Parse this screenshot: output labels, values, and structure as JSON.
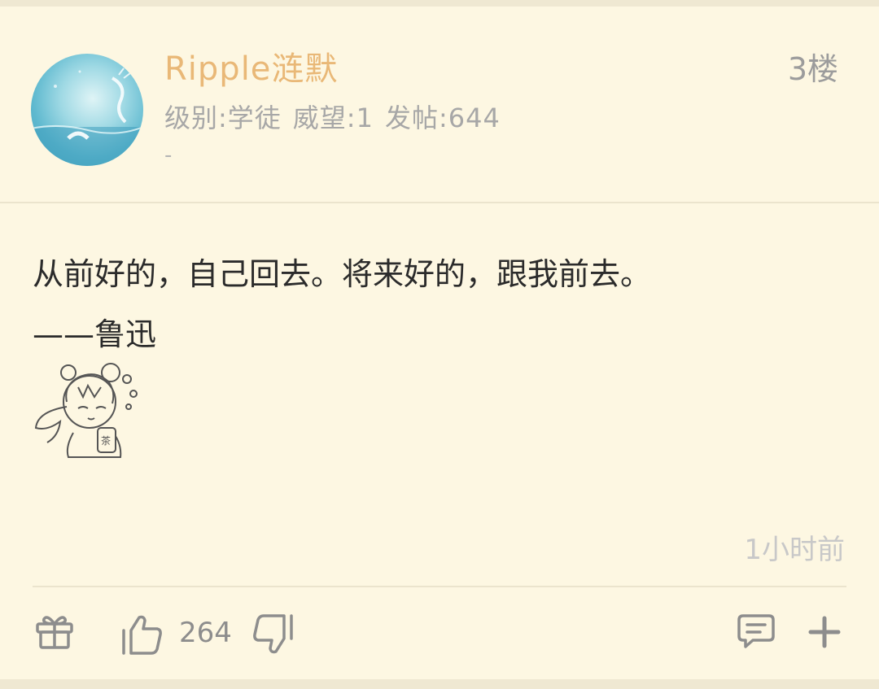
{
  "post": {
    "username": "Ripple涟默",
    "floor": "3楼",
    "meta": {
      "level": "级别:学徒",
      "prestige": "威望:1",
      "posts": "发帖:644"
    },
    "signature": "-",
    "content": [
      "从前好的，自己回去。将来好的，跟我前去。",
      "——鲁迅"
    ],
    "sticker": "chibi-girl-sticker",
    "timestamp": "1小时前",
    "likes": "264"
  },
  "actions": {
    "gift_icon": "gift-icon",
    "like_icon": "thumbs-up-icon",
    "dislike_icon": "thumbs-down-icon",
    "comment_icon": "comment-icon",
    "more_icon": "plus-icon"
  },
  "colors": {
    "background": "#fdf7e2",
    "username": "#e9b877",
    "meta_text": "#a7a7a7",
    "body_text": "#2b2b2b",
    "timestamp": "#c8c8c8",
    "icon": "#8d8d8d",
    "divider": "#ebe4cd"
  }
}
